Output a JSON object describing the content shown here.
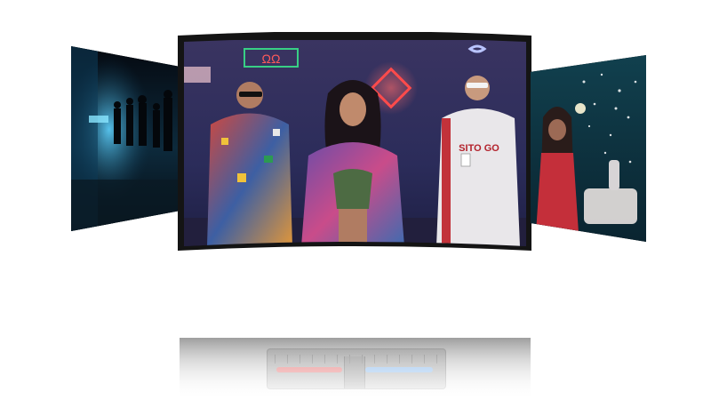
{
  "carousel": {
    "left_video": {
      "scene": "dark-dance-scene"
    },
    "main_video": {
      "sign_text": "ΩΩ",
      "jersey_text": "SITO GO"
    },
    "right_video": {
      "scene": "confetti-bed-scene"
    }
  },
  "control_bar_reflection": {
    "left_bar_color": "#e98a8a",
    "right_bar_color": "#9cc4ef"
  }
}
